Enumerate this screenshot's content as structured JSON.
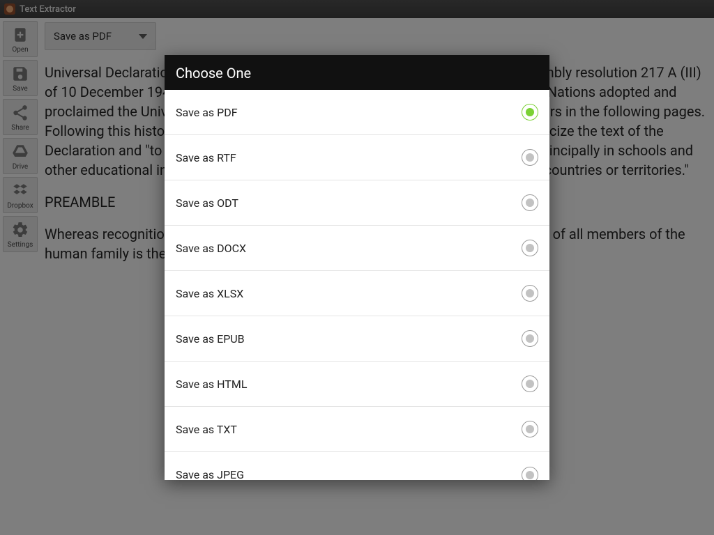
{
  "titlebar": {
    "title": "Text Extractor"
  },
  "sidebar": {
    "items": [
      {
        "name": "open",
        "label": "Open"
      },
      {
        "name": "save",
        "label": "Save"
      },
      {
        "name": "share",
        "label": "Share"
      },
      {
        "name": "drive",
        "label": "Drive"
      },
      {
        "name": "dropbox",
        "label": "Dropbox"
      },
      {
        "name": "settings",
        "label": "Settings"
      }
    ]
  },
  "dropdown": {
    "selected": "Save as PDF"
  },
  "document": {
    "p1": "Universal Declaration of Human Rights Adopted and proclaimed by General Assembly resolution 217 A (III) of 10 December 1948 On December 10, 1948 the General Assembly of the United Nations adopted and proclaimed the Universal Declaration of Human Rights the full text of which appears in the following pages. Following this historic act the Assembly called upon all Member countries to publicize the text of the Declaration and \"to cause it to be disseminated, displayed, read and expounded principally in schools and other educational institutions, without distinction based on the political status of countries or territories.\"",
    "p2": "PREAMBLE",
    "p3": "Whereas recognition of the inherent dignity and of the equal and inalienable rights of all members of the human family is the foundation of freedom, justice and peace in the world,"
  },
  "dialog": {
    "title": "Choose One",
    "options": [
      {
        "label": "Save as PDF",
        "selected": true
      },
      {
        "label": "Save as RTF",
        "selected": false
      },
      {
        "label": "Save as ODT",
        "selected": false
      },
      {
        "label": "Save as DOCX",
        "selected": false
      },
      {
        "label": "Save as XLSX",
        "selected": false
      },
      {
        "label": "Save as EPUB",
        "selected": false
      },
      {
        "label": "Save as HTML",
        "selected": false
      },
      {
        "label": "Save as TXT",
        "selected": false
      },
      {
        "label": "Save as JPEG",
        "selected": false
      }
    ]
  }
}
